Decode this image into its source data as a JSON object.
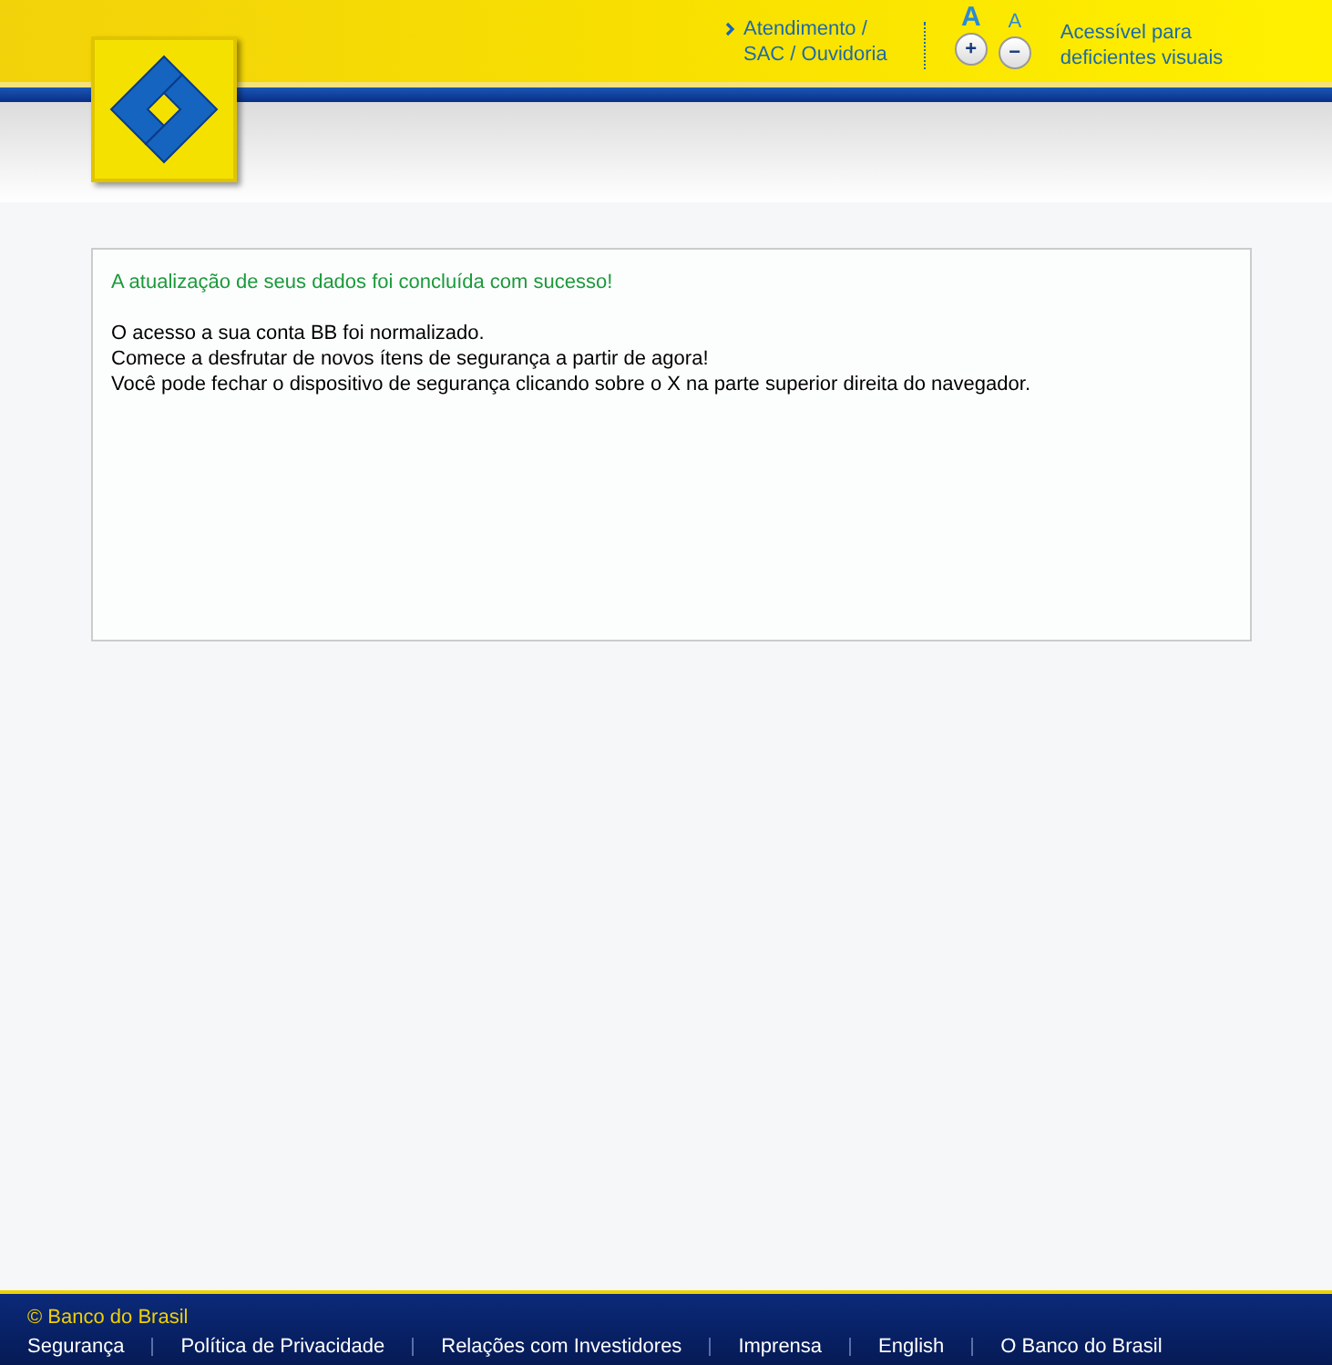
{
  "header": {
    "service_link": {
      "lines": [
        "Atendimento /",
        "SAC / Ouvidoria"
      ]
    },
    "font_size": {
      "controls": [
        {
          "letter": "A",
          "button": "+",
          "kind": "large"
        },
        {
          "letter": "A",
          "button": "−",
          "kind": "small"
        }
      ]
    },
    "accessibility_link": {
      "lines": [
        "Acessível para",
        "deficientes visuais"
      ]
    }
  },
  "message": {
    "success": "A atualização de seus dados foi concluída com sucesso!",
    "lines": [
      "O acesso a sua conta BB foi normalizado.",
      "Comece a desfrutar de novos ítens de segurança a partir de agora!",
      "Você pode fechar o dispositivo de segurança clicando sobre o X na parte superior direita do navegador."
    ]
  },
  "footer": {
    "copyright": "© Banco do Brasil",
    "links": [
      "Segurança",
      "Política de Privacidade",
      "Relações com Investidores",
      "Imprensa",
      "English",
      "O Banco do Brasil"
    ]
  }
}
